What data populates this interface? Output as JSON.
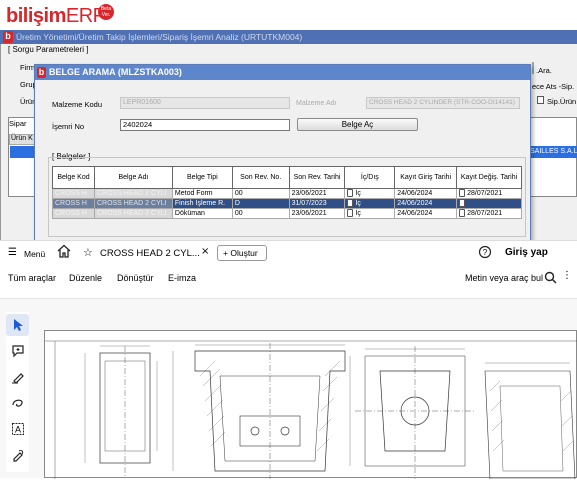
{
  "erp": {
    "logo_text": "bilişim",
    "logo_erp": "ERP",
    "beta_line1": "Beta",
    "beta_line2": "Ver.",
    "window_title": "Üretim Yönetimi/Üretim Takip İşlemleri/Sipariş İşemri Analiz (URTUTKM004)",
    "sorgu_legend": "[ Sorgu Parametreleri ]",
    "labels": {
      "firma": "Firma",
      "grup": "Grup",
      "urun": "Ürün",
      "ara": ".Ara.",
      "ece_ats_sip": "ece  Ats -Sip.",
      "sip_urun": "Sip.Ürün"
    },
    "sipar_tab": "Sipar",
    "urun_k_header": "Ürün K",
    "right_row_text": "SAILLES S.A.L"
  },
  "modal": {
    "title": "BELGE ARAMA (MLZSTKA003)",
    "malzeme_kodu_label": "Malzeme Kodu",
    "malzeme_kodu_value": "LEPR01600",
    "malzeme_adi_label": "Malzeme Adı",
    "malzeme_adi_value": "CROSS HEAD 2 CYLINDER (STR-COO-DI14141)",
    "isemri_no_label": "İşemri No",
    "isemri_no_value": "2402024",
    "belge_ac_button": "Belge Aç",
    "belgeler_legend": "[ Belgeler ]",
    "table": {
      "headers": [
        "Belge Kod",
        "Belge Adı",
        "Belge Tipi",
        "Son Rev. No.",
        "Son Rev. Tarihi",
        "İç/Dış",
        "Kayıt Giriş Tarihi",
        "Kayıt Değiş. Tarihi"
      ],
      "rows": [
        {
          "kod": "CROSS H",
          "adi": "CROSS HEAD 2 CYLI",
          "tip": "Metod Form",
          "rev_no": "00",
          "rev_tarih": "23/06/2021",
          "ic_dis": "İç",
          "giris": "24/06/2024",
          "degis": "28/07/2021",
          "selected": false
        },
        {
          "kod": "CROSS H",
          "adi": "CROSS HEAD 2 CYLI",
          "tip": "Finish İşleme R.",
          "rev_no": "D",
          "rev_tarih": "31/07/2023",
          "ic_dis": "İç",
          "giris": "24/06/2024",
          "degis": "",
          "selected": true
        },
        {
          "kod": "CROSS H",
          "adi": "CROSS HEAD 2 CYLI",
          "tip": "Döküman",
          "rev_no": "00",
          "rev_tarih": "23/06/2021",
          "ic_dis": "İç",
          "giris": "24/06/2024",
          "degis": "28/07/2021",
          "selected": false
        }
      ]
    }
  },
  "pdf": {
    "menu_label": "Menü",
    "tab_title": "CROSS HEAD 2 CYL...",
    "create_button": "Oluştur",
    "login_button": "Giriş yap",
    "toolbar_items": [
      "Tüm araçlar",
      "Düzenle",
      "Dönüştür",
      "E-imza"
    ],
    "search_placeholder": "Metin veya araç bul"
  }
}
